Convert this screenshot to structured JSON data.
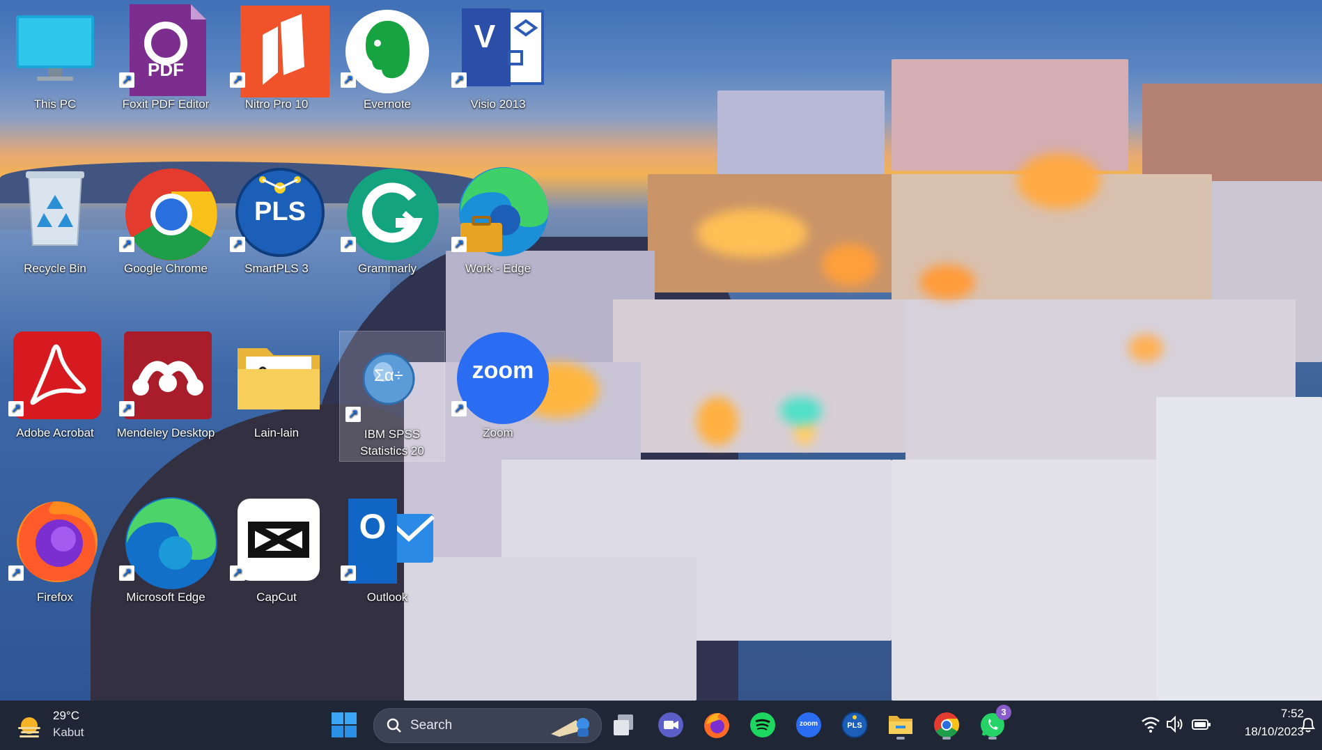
{
  "desktop": {
    "icons": [
      {
        "label": "This PC",
        "icon": "monitor-icon",
        "shortcut": false
      },
      {
        "label": "Foxit PDF Editor",
        "icon": "foxit-pdf-icon",
        "shortcut": true
      },
      {
        "label": "Nitro Pro 10",
        "icon": "nitro-icon",
        "shortcut": true
      },
      {
        "label": "Evernote",
        "icon": "evernote-elephant-icon",
        "shortcut": true
      },
      {
        "label": "Visio 2013",
        "icon": "visio-icon",
        "shortcut": true
      },
      {
        "label": "Recycle Bin",
        "icon": "recycle-bin-icon",
        "shortcut": false
      },
      {
        "label": "Google Chrome",
        "icon": "chrome-icon",
        "shortcut": true
      },
      {
        "label": "SmartPLS 3",
        "icon": "smartpls-icon",
        "shortcut": true
      },
      {
        "label": "Grammarly",
        "icon": "grammarly-icon",
        "shortcut": true
      },
      {
        "label": "Work - Edge",
        "icon": "edge-work-icon",
        "shortcut": true
      },
      {
        "label": "Adobe Acrobat",
        "icon": "acrobat-icon",
        "shortcut": true
      },
      {
        "label": "Mendeley Desktop",
        "icon": "mendeley-icon",
        "shortcut": true
      },
      {
        "label": "Lain-lain",
        "icon": "folder-icon",
        "shortcut": false
      },
      {
        "label": "IBM SPSS Statistics 20",
        "icon": "spss-icon",
        "shortcut": true
      },
      {
        "label": "Zoom",
        "icon": "zoom-icon",
        "shortcut": true
      },
      {
        "label": "Firefox",
        "icon": "firefox-icon",
        "shortcut": true
      },
      {
        "label": "Microsoft Edge",
        "icon": "edge-icon",
        "shortcut": true
      },
      {
        "label": "CapCut",
        "icon": "capcut-icon",
        "shortcut": true
      },
      {
        "label": "Outlook",
        "icon": "outlook-icon",
        "shortcut": true
      }
    ],
    "icon_texts": {
      "foxit": "PDF",
      "visio": "V",
      "smartpls": "PLS",
      "zoom": "zoom",
      "outlook": "O",
      "spss": "Σα÷"
    }
  },
  "taskbar": {
    "weather": {
      "temp": "29°C",
      "condition": "Kabut",
      "icon": "sun-haze-icon"
    },
    "search_placeholder": "Search",
    "apps": [
      {
        "name": "start",
        "icon": "windows-start-icon"
      },
      {
        "name": "task-view",
        "icon": "task-view-icon"
      },
      {
        "name": "meet",
        "icon": "video-camera-icon"
      },
      {
        "name": "firefox",
        "icon": "firefox-icon"
      },
      {
        "name": "spotify",
        "icon": "spotify-icon"
      },
      {
        "name": "zoom",
        "icon": "zoom-icon",
        "text": "zoom"
      },
      {
        "name": "smartpls",
        "icon": "smartpls-icon",
        "text": "PLS"
      },
      {
        "name": "file-explorer",
        "icon": "folder-icon"
      },
      {
        "name": "chrome",
        "icon": "chrome-icon"
      },
      {
        "name": "whatsapp",
        "icon": "whatsapp-icon",
        "badge": "3"
      }
    ],
    "tray": {
      "icons": [
        "wifi-icon",
        "volume-icon",
        "battery-icon",
        "notification-bell-icon"
      ],
      "time": "7:52",
      "date": "18/10/2023"
    }
  },
  "colors": {
    "taskbar_bg": "#1f2636",
    "accent": "#1a6fd6"
  }
}
